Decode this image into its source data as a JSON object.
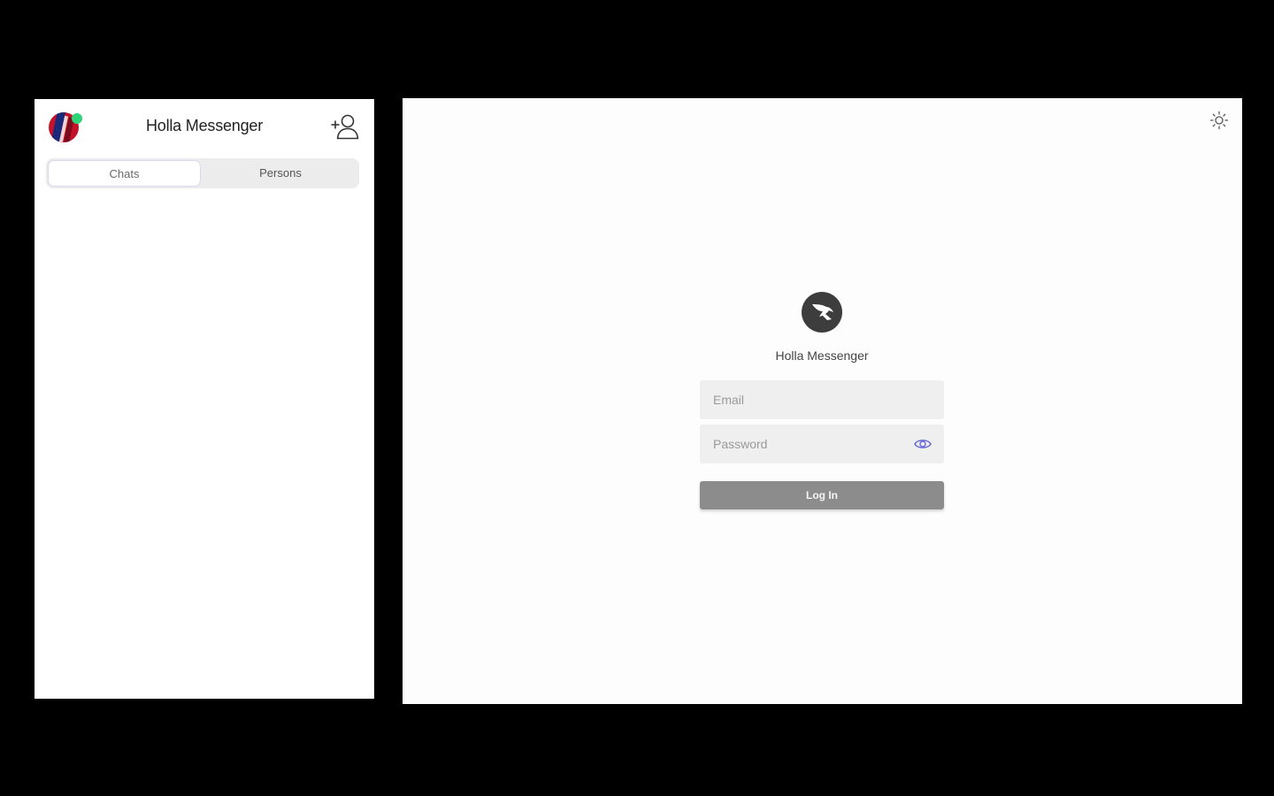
{
  "colors": {
    "backdrop": "#000000",
    "panel": "#ffffff",
    "accent": "#6a6ad8",
    "online": "#2fd476",
    "button": "#8c8c8c"
  },
  "mobile": {
    "header": {
      "title": "Holla Messenger",
      "avatar_icon": "user-avatar",
      "status_icon": "online-dot",
      "add_icon": "add-person-icon"
    },
    "tabs": [
      {
        "label": "Chats",
        "active": true
      },
      {
        "label": "Persons",
        "active": false
      }
    ],
    "chats": []
  },
  "desktop": {
    "theme_icon": "sun-icon",
    "login": {
      "logo_icon": "bird-logo-icon",
      "title": "Holla Messenger",
      "email": {
        "value": "",
        "placeholder": "Email"
      },
      "password": {
        "value": "",
        "placeholder": "Password",
        "toggle_icon": "eye-icon"
      },
      "submit_label": "Log In"
    }
  }
}
